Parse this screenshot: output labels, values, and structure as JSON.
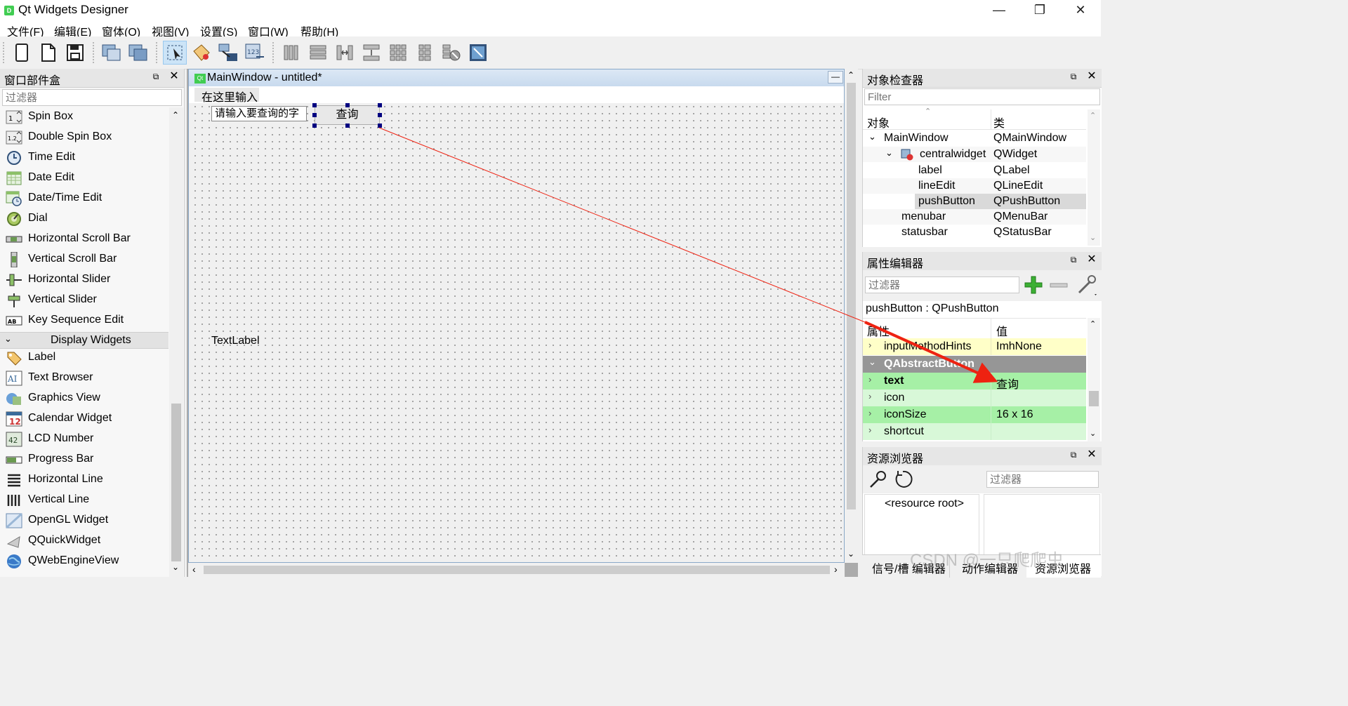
{
  "window": {
    "title": "Qt Widgets Designer",
    "minimize_glyph": "—",
    "restore_glyph": "❐",
    "close_glyph": "✕"
  },
  "menu": [
    "文件(F)",
    "编辑(E)",
    "窗体(O)",
    "视图(V)",
    "设置(S)",
    "窗口(W)",
    "帮助(H)"
  ],
  "widget_box": {
    "title": "窗口部件盒",
    "filter_placeholder": "过滤器",
    "items_input": [
      {
        "label": "Spin Box",
        "icon": "spin-box-icon"
      },
      {
        "label": "Double Spin Box",
        "icon": "double-spin-box-icon"
      },
      {
        "label": "Time Edit",
        "icon": "clock-icon"
      },
      {
        "label": "Date Edit",
        "icon": "calendar-grid-icon"
      },
      {
        "label": "Date/Time Edit",
        "icon": "calendar-clock-icon"
      },
      {
        "label": "Dial",
        "icon": "dial-icon"
      },
      {
        "label": "Horizontal Scroll Bar",
        "icon": "hscrollbar-icon"
      },
      {
        "label": "Vertical Scroll Bar",
        "icon": "vscrollbar-icon"
      },
      {
        "label": "Horizontal Slider",
        "icon": "hslider-icon"
      },
      {
        "label": "Vertical Slider",
        "icon": "vslider-icon"
      },
      {
        "label": "Key Sequence Edit",
        "icon": "key-sequence-icon"
      }
    ],
    "category_display": "Display Widgets",
    "items_display": [
      {
        "label": "Label",
        "icon": "label-tag-icon"
      },
      {
        "label": "Text Browser",
        "icon": "text-browser-icon"
      },
      {
        "label": "Graphics View",
        "icon": "graphics-view-icon"
      },
      {
        "label": "Calendar Widget",
        "icon": "calendar-icon"
      },
      {
        "label": "LCD Number",
        "icon": "lcd-icon"
      },
      {
        "label": "Progress Bar",
        "icon": "progress-bar-icon"
      },
      {
        "label": "Horizontal Line",
        "icon": "hline-icon"
      },
      {
        "label": "Vertical Line",
        "icon": "vline-icon"
      },
      {
        "label": "OpenGL Widget",
        "icon": "opengl-icon"
      },
      {
        "label": "QQuickWidget",
        "icon": "quick-widget-icon"
      },
      {
        "label": "QWebEngineView",
        "icon": "globe-icon"
      }
    ]
  },
  "form": {
    "title": "MainWindow - untitled*",
    "menu_placeholder": "在这里输入",
    "line_edit_text": "请输入要查询的字",
    "button_text": "查询",
    "text_label": "TextLabel"
  },
  "object_inspector": {
    "title": "对象检查器",
    "filter_placeholder": "Filter",
    "col_object": "对象",
    "col_class": "类",
    "rows": [
      {
        "object": "MainWindow",
        "class": "QMainWindow"
      },
      {
        "object": "centralwidget",
        "class": "QWidget"
      },
      {
        "object": "label",
        "class": "QLabel"
      },
      {
        "object": "lineEdit",
        "class": "QLineEdit"
      },
      {
        "object": "pushButton",
        "class": "QPushButton"
      },
      {
        "object": "menubar",
        "class": "QMenuBar"
      },
      {
        "object": "statusbar",
        "class": "QStatusBar"
      }
    ]
  },
  "property_editor": {
    "title": "属性编辑器",
    "filter_placeholder": "过滤器",
    "object_label": "pushButton : QPushButton",
    "col_property": "属性",
    "col_value": "值",
    "group": "QAbstractButton",
    "rows_before": [
      {
        "name": "inputMethodHints",
        "value": "ImhNone"
      }
    ],
    "rows": [
      {
        "name": "text",
        "value": "查询"
      },
      {
        "name": "icon",
        "value": ""
      },
      {
        "name": "iconSize",
        "value": "16 x 16"
      },
      {
        "name": "shortcut",
        "value": ""
      }
    ]
  },
  "resource_browser": {
    "title": "资源浏览器",
    "filter_placeholder": "过滤器",
    "root": "<resource root>"
  },
  "bottom_tabs": [
    "信号/槽 编辑器",
    "动作编辑器",
    "资源浏览器"
  ],
  "watermark": "CSDN @一只爬爬虫",
  "colors": {
    "selection_green": "#a6f0a6",
    "hint_yellow": "#ffffc8",
    "arrow_red": "#ee2211",
    "group_header": "#969696"
  }
}
